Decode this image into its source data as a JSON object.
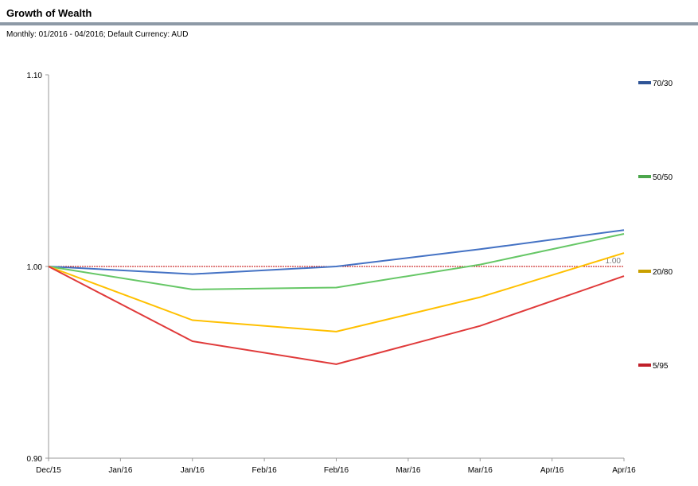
{
  "header": {
    "title": "Growth of Wealth",
    "subtitle": "Monthly: 01/2016 - 04/2016; Default Currency: AUD"
  },
  "chart_data": {
    "type": "line",
    "title": "Growth of Wealth",
    "xlabel": "",
    "ylabel": "",
    "x_ticks": [
      "Dec/15",
      "Jan/16",
      "Jan/16",
      "Feb/16",
      "Feb/16",
      "Mar/16",
      "Mar/16",
      "Apr/16",
      "Apr/16"
    ],
    "x": [
      "Dec/15",
      "Jan/16",
      "Feb/16",
      "Mar/16",
      "Apr/16"
    ],
    "y_ticks": [
      "1.10",
      "1.00",
      "0.90"
    ],
    "ylim": [
      0.9,
      1.1
    ],
    "reference_line": {
      "value": 1.0,
      "label": "1.00",
      "color": "#c00000"
    },
    "legend_position": "right",
    "grid": false,
    "series": [
      {
        "name": "70/30",
        "color": "#4472c4",
        "legend_color": "#2f5597",
        "values": [
          1.0,
          0.996,
          1.0,
          1.009,
          1.019
        ]
      },
      {
        "name": "50/50",
        "color": "#66c766",
        "legend_color": "#4ca64c",
        "values": [
          1.0,
          0.988,
          0.989,
          1.001,
          1.017
        ]
      },
      {
        "name": "20/80",
        "color": "#ffc000",
        "legend_color": "#c9a000",
        "values": [
          1.0,
          0.972,
          0.966,
          0.984,
          1.007
        ]
      },
      {
        "name": "5/95",
        "color": "#e03a3a",
        "legend_color": "#c0202a",
        "values": [
          1.0,
          0.961,
          0.949,
          0.969,
          0.995
        ]
      }
    ]
  }
}
